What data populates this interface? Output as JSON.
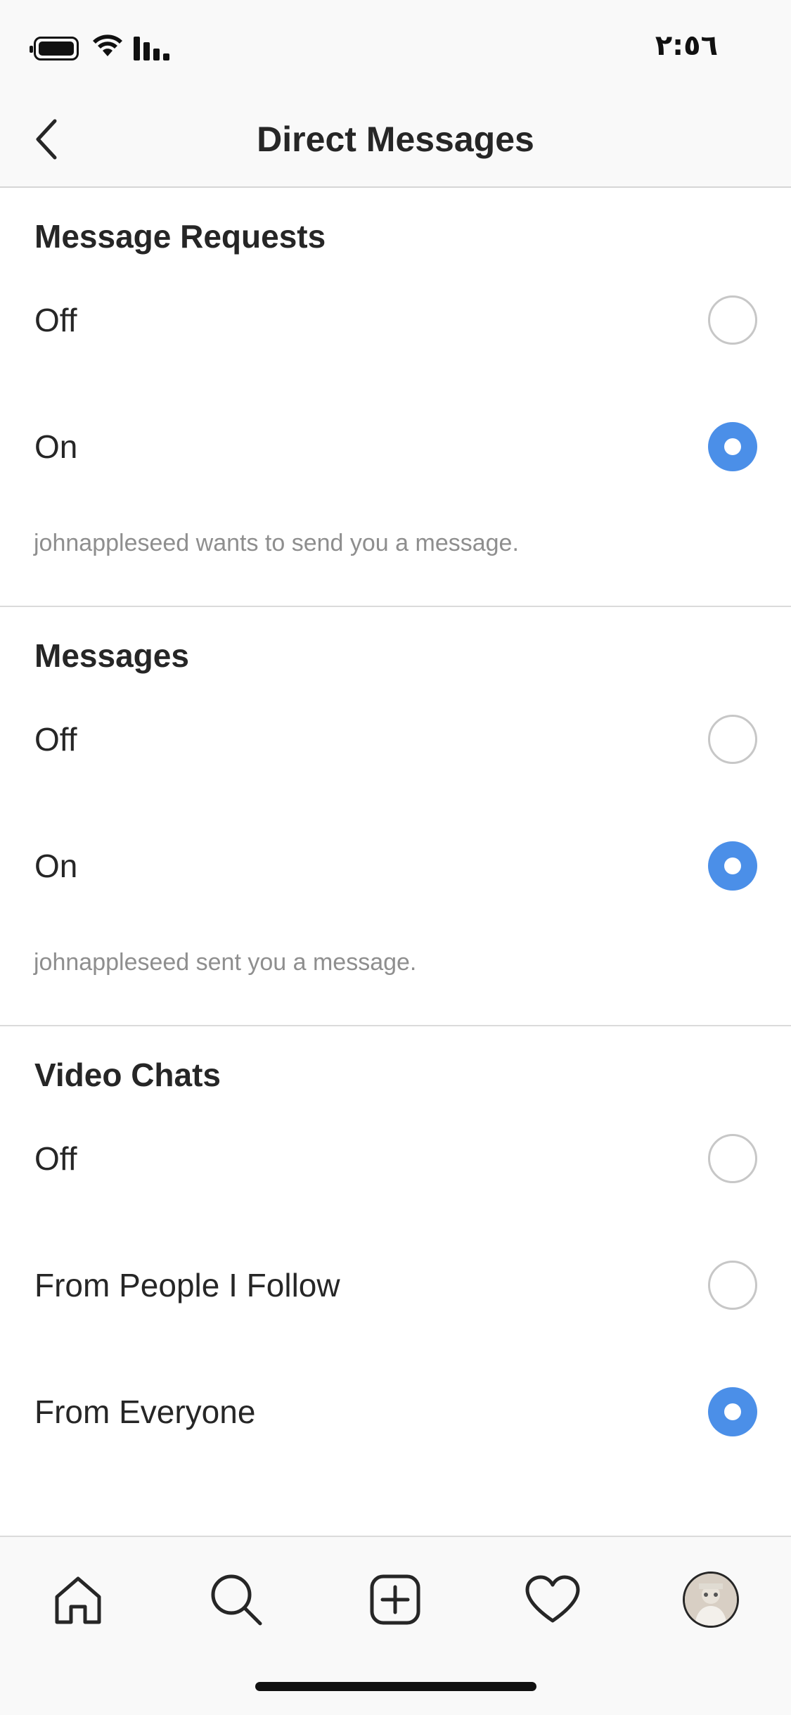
{
  "status_bar": {
    "time": "٢:٥٦"
  },
  "nav": {
    "title": "Direct Messages"
  },
  "sections": [
    {
      "title": "Message Requests",
      "options": [
        {
          "label": "Off",
          "selected": false
        },
        {
          "label": "On",
          "selected": true
        }
      ],
      "caption": "johnappleseed wants to send you a message."
    },
    {
      "title": "Messages",
      "options": [
        {
          "label": "Off",
          "selected": false
        },
        {
          "label": "On",
          "selected": true
        }
      ],
      "caption": "johnappleseed sent you a message."
    },
    {
      "title": "Video Chats",
      "options": [
        {
          "label": "Off",
          "selected": false
        },
        {
          "label": "From People I Follow",
          "selected": false
        },
        {
          "label": "From Everyone",
          "selected": true
        }
      ]
    }
  ],
  "tab_bar": {
    "icons": [
      "home-icon",
      "search-icon",
      "new-post-icon",
      "activity-heart-icon",
      "profile-avatar"
    ]
  },
  "colors": {
    "accent": "#4b8fe8",
    "caption": "#8e8e8e",
    "divider": "#dbdbdb"
  }
}
